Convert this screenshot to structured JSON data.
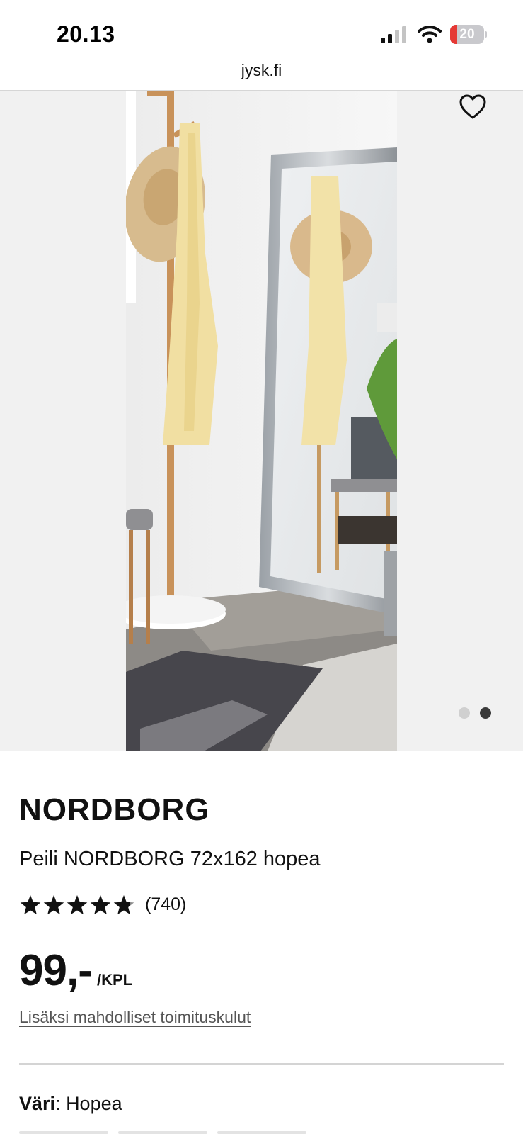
{
  "status_bar": {
    "time": "20.13",
    "battery_level": "20",
    "battery_fraction": 0.2
  },
  "browser": {
    "url": "jysk.fi"
  },
  "gallery": {
    "active_index": 2,
    "total_images": 2
  },
  "product": {
    "brand": "NORDBORG",
    "name": "Peili NORDBORG 72x162 hopea",
    "rating_stars": 4.8,
    "rating_count": "(740)",
    "price": "99,-",
    "unit": "/KPL",
    "shipping_note": "Lisäksi mahdolliset toimituskulut",
    "color_label": "Väri",
    "color_separator": ": ",
    "color_value": "Hopea"
  },
  "colors": {
    "battery_low": "#e53935",
    "text": "#111111",
    "gallery_bg": "#f1f1f1"
  }
}
